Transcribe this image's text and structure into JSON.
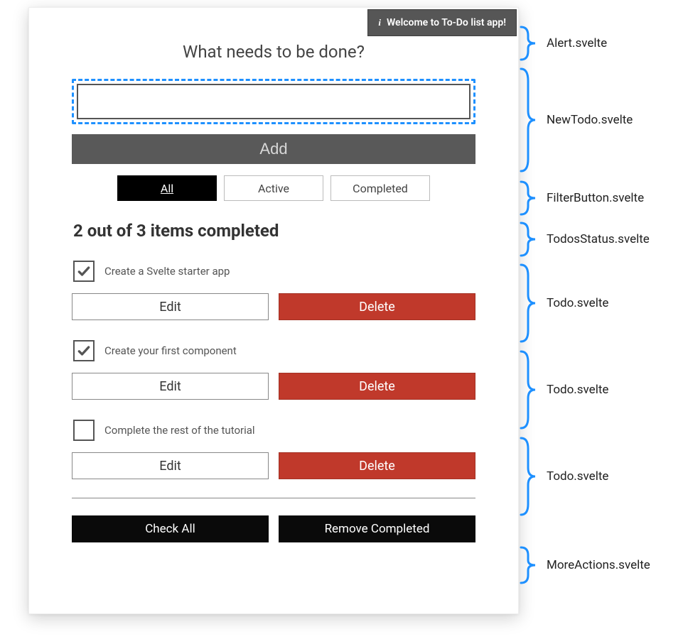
{
  "alert": {
    "icon": "i",
    "text": "Welcome to To-Do list app!"
  },
  "newTodo": {
    "prompt": "What needs to be done?",
    "placeholder": "",
    "addLabel": "Add"
  },
  "filters": {
    "all": "All",
    "active": "Active",
    "completed": "Completed"
  },
  "status": {
    "text": "2 out of 3 items completed"
  },
  "todos": [
    {
      "label": "Create a Svelte starter app",
      "checked": true,
      "edit": "Edit",
      "del": "Delete"
    },
    {
      "label": "Create your first component",
      "checked": true,
      "edit": "Edit",
      "del": "Delete"
    },
    {
      "label": "Complete the rest of the tutorial",
      "checked": false,
      "edit": "Edit",
      "del": "Delete"
    }
  ],
  "moreActions": {
    "checkAll": "Check All",
    "removeCompleted": "Remove Completed"
  },
  "annotations": {
    "alert": "Alert.svelte",
    "newTodo": "NewTodo.svelte",
    "filterButton": "FilterButton.svelte",
    "todosStatus": "TodosStatus.svelte",
    "todo": "Todo.svelte",
    "moreActions": "MoreActions.svelte"
  }
}
